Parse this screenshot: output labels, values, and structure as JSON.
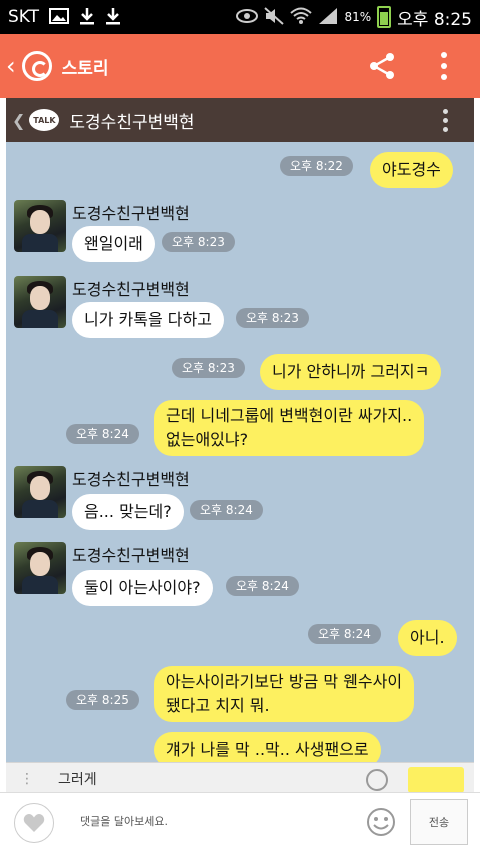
{
  "status_bar": {
    "carrier": "SKT",
    "battery": "81%",
    "time": "오후 8:25",
    "icons": [
      "image-icon",
      "download-icon",
      "download-icon",
      "eye-icon",
      "mute-icon",
      "wifi-icon",
      "signal-icon",
      "battery-icon"
    ]
  },
  "app_bar": {
    "title": "스토리",
    "accent": "#f36c4f"
  },
  "chat_header": {
    "title": "도경수친구변백현",
    "logo": "TALK"
  },
  "chat": {
    "background": "#b2c7d9",
    "my_bubble_color": "#fdf060",
    "their_bubble_color": "#ffffff",
    "messages": [
      {
        "from": "me",
        "text": "야도경수",
        "time": "오후 8:22"
      },
      {
        "from": "other",
        "sender": "도경수친구변백현",
        "text": "왠일이래",
        "time": "오후 8:23"
      },
      {
        "from": "other",
        "sender": "도경수친구변백현",
        "text": "니가 카톡을 다하고",
        "time": "오후 8:23"
      },
      {
        "from": "me",
        "text": "니가 안하니까 그러지ㅋ",
        "time": "오후 8:23"
      },
      {
        "from": "me",
        "lines": [
          "근데 니네그룹에 변백현이란 싸가지..",
          "없는애있냐?"
        ],
        "time": "오후 8:24"
      },
      {
        "from": "other",
        "sender": "도경수친구변백현",
        "text": "음... 맞는데?",
        "time": "오후 8:24"
      },
      {
        "from": "other",
        "sender": "도경수친구변백현",
        "text": "둘이 아는사이야?",
        "time": "오후 8:24"
      },
      {
        "from": "me",
        "text": "아니.",
        "time": "오후 8:24"
      },
      {
        "from": "me",
        "lines": [
          "아는사이라기보단 방금 막 웬수사이",
          "됐다고 치지 뭐."
        ],
        "time": "오후 8:25"
      },
      {
        "from": "me",
        "text": "걔가 나를 막 ..막.. 사생팬으로",
        "time": ""
      }
    ]
  },
  "chat_input": {
    "value": "그러게"
  },
  "comment_bar": {
    "placeholder": "댓글을 달아보세요.",
    "send_label": "전송"
  }
}
